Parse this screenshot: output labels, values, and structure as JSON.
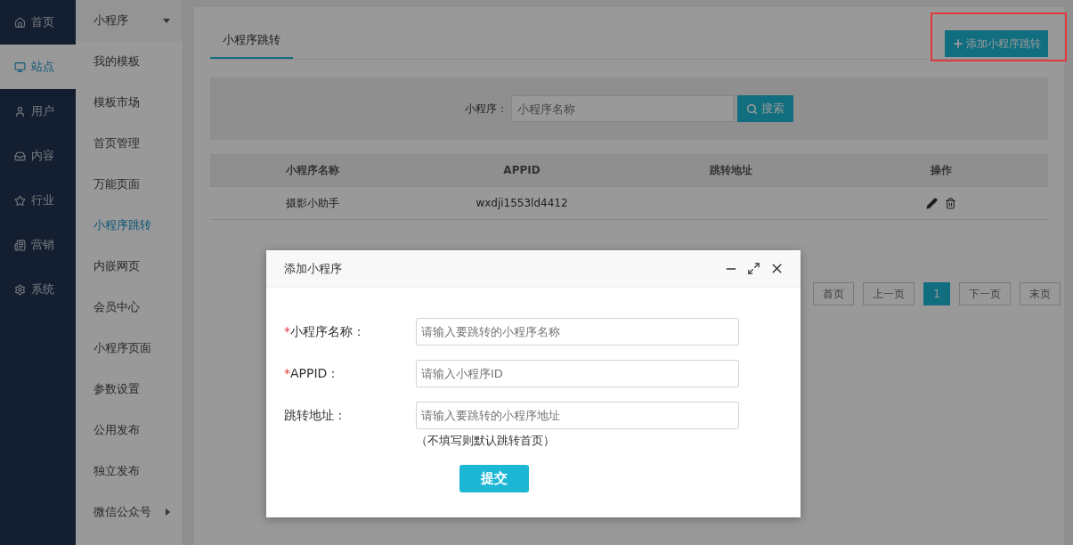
{
  "nav": [
    {
      "label": "首页",
      "selected": false
    },
    {
      "label": "站点",
      "selected": true
    },
    {
      "label": "用户",
      "selected": false
    },
    {
      "label": "内容",
      "selected": false
    },
    {
      "label": "行业",
      "selected": false
    },
    {
      "label": "营销",
      "selected": false
    },
    {
      "label": "系统",
      "selected": false
    }
  ],
  "sub_nav": {
    "header": "小程序",
    "expanded": true,
    "items": [
      {
        "label": "我的模板",
        "selected": false,
        "kind": "link"
      },
      {
        "label": "模板市场",
        "selected": false,
        "kind": "link"
      },
      {
        "label": "首页管理",
        "selected": false,
        "kind": "link"
      },
      {
        "label": "万能页面",
        "selected": false,
        "kind": "link"
      },
      {
        "label": "小程序跳转",
        "selected": true,
        "kind": "link"
      },
      {
        "label": "内嵌网页",
        "selected": false,
        "kind": "link"
      },
      {
        "label": "会员中心",
        "selected": false,
        "kind": "link"
      },
      {
        "label": "小程序页面",
        "selected": false,
        "kind": "link"
      },
      {
        "label": "参数设置",
        "selected": false,
        "kind": "link"
      },
      {
        "label": "公用发布",
        "selected": false,
        "kind": "link"
      },
      {
        "label": "独立发布",
        "selected": false,
        "kind": "link"
      },
      {
        "label": "微信公众号",
        "selected": false,
        "kind": "submenu"
      }
    ]
  },
  "tabs": [
    {
      "label": "小程序跳转",
      "selected": true
    }
  ],
  "add_button": "添加小程序跳转",
  "search": {
    "label": "小程序：",
    "placeholder": "小程序名称",
    "button": "搜索"
  },
  "table": {
    "columns": [
      "小程序名称",
      "APPID",
      "跳转地址",
      "操作"
    ],
    "rows": [
      {
        "cells": [
          "摄影小助手",
          "wxdji1553ld4412"
        ]
      }
    ]
  },
  "pagination": [
    {
      "label": "首页",
      "selected": false
    },
    {
      "label": "上一页",
      "selected": false
    },
    {
      "label": "1",
      "selected": true
    },
    {
      "label": "下一页",
      "selected": false
    },
    {
      "label": "末页",
      "selected": false
    }
  ],
  "dialog": {
    "title": "添加小程序",
    "fields": [
      {
        "mark": "*",
        "label": "小程序名称：",
        "placeholder": "请输入要跳转的小程序名称"
      },
      {
        "mark": "*",
        "label": "APPID：",
        "placeholder": "请输入小程序ID"
      },
      {
        "label": "跳转地址：",
        "placeholder": "请输入要跳转的小程序地址"
      }
    ],
    "hint": "（不填写则默认跳转首页）",
    "submit": "提交"
  }
}
